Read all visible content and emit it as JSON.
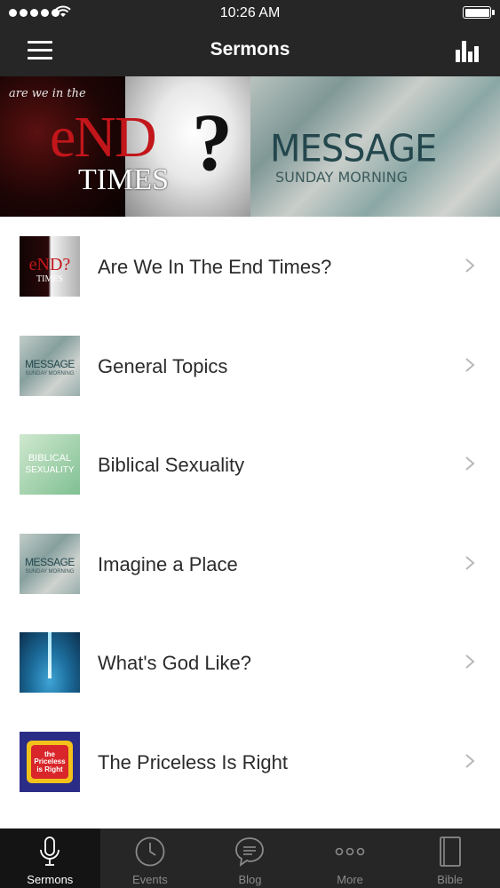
{
  "status_bar": {
    "time": "10:26 AM"
  },
  "header": {
    "title": "Sermons"
  },
  "banner": {
    "left": {
      "small_text": "are we in the",
      "big_text": "eND",
      "question_mark": "?",
      "times_text": "TIMES"
    },
    "right": {
      "title": "MESSAGE",
      "subtitle": "SUNDAY MORNING"
    }
  },
  "sermon_list": [
    {
      "label": "Are We In The End Times?",
      "thumb_text": "eND?",
      "thumb_sub": "TIMES"
    },
    {
      "label": "General Topics",
      "thumb_text": "MESSAGE",
      "thumb_sub": "SUNDAY MORNING"
    },
    {
      "label": "Biblical Sexuality",
      "thumb_text": "BIBLICAL",
      "thumb_sub": "SEXUALITY"
    },
    {
      "label": "Imagine a Place",
      "thumb_text": "MESSAGE",
      "thumb_sub": "SUNDAY MORNING"
    },
    {
      "label": "What's God Like?",
      "thumb_text": "",
      "thumb_sub": ""
    },
    {
      "label": "The Priceless Is Right",
      "thumb_text": "the Priceless is Right",
      "thumb_sub": ""
    }
  ],
  "tab_bar": {
    "tabs": [
      {
        "label": "Sermons",
        "icon": "microphone-icon",
        "active": true
      },
      {
        "label": "Events",
        "icon": "clock-icon",
        "active": false
      },
      {
        "label": "Blog",
        "icon": "chat-bubble-icon",
        "active": false
      },
      {
        "label": "More",
        "icon": "more-dots-icon",
        "active": false
      },
      {
        "label": "Bible",
        "icon": "book-icon",
        "active": false
      }
    ]
  },
  "colors": {
    "bar_background": "#262626",
    "active_tab_background": "#141414",
    "inactive_tab_label": "#8a8a8a",
    "end_red": "#c2161b",
    "message_teal": "#24474d"
  }
}
